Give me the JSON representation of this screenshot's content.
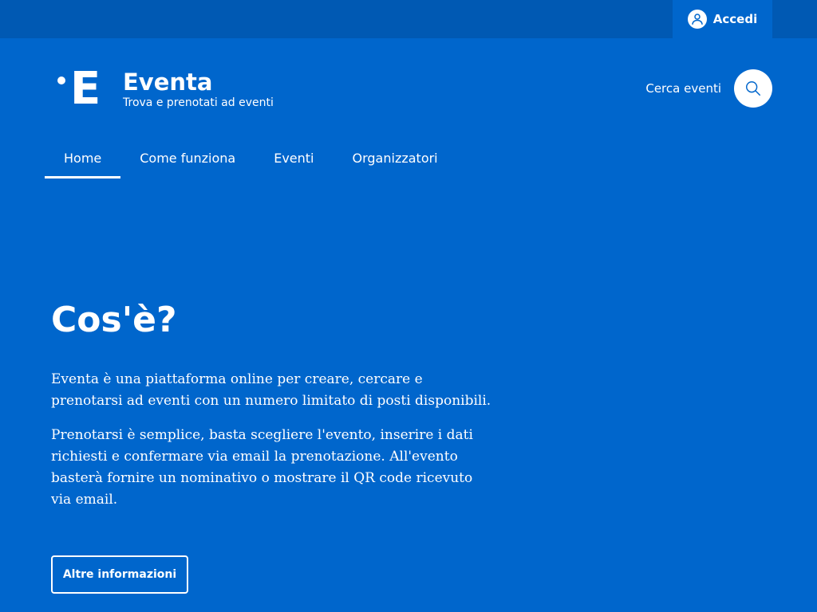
{
  "colors": {
    "background": "#0066cc",
    "topbar": "#0059b3",
    "foreground": "#ffffff"
  },
  "topbar": {
    "login_label": "Accedi",
    "login_icon": "user-icon"
  },
  "brand": {
    "logo_letter": "E",
    "name": "Eventa",
    "tagline": "Trova e prenotati ad eventi"
  },
  "search": {
    "label": "Cerca eventi",
    "icon": "search-icon"
  },
  "nav": {
    "items": [
      {
        "label": "Home",
        "active": true
      },
      {
        "label": "Come funziona",
        "active": false
      },
      {
        "label": "Eventi",
        "active": false
      },
      {
        "label": "Organizzatori",
        "active": false
      }
    ]
  },
  "hero": {
    "title": "Cos'è?",
    "paragraph1": "Eventa è una piattaforma online per creare, cercare e prenotarsi ad eventi con un numero limitato di posti disponibili.",
    "paragraph2": "Prenotarsi è semplice, basta scegliere l'evento, inserire i dati richiesti e confermare via email la prenotazione. All'evento basterà fornire un nominativo o mostrare il QR code ricevuto via email.",
    "button_label": "Altre informazioni"
  }
}
